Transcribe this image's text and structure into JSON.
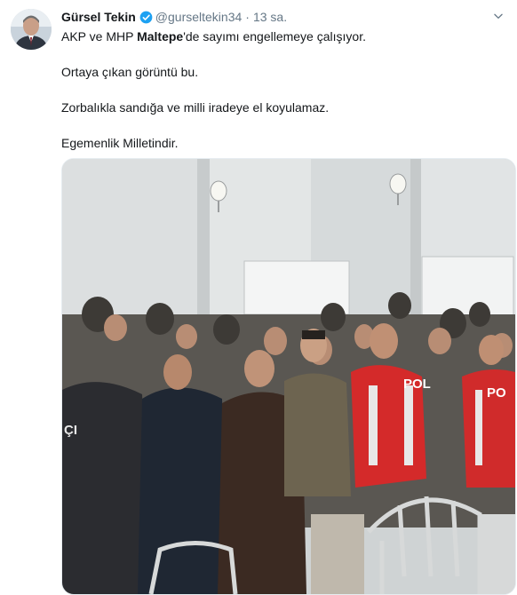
{
  "user": {
    "display_name": "Gürsel Tekin",
    "handle": "@gurseltekin34",
    "time": "13 sa.",
    "separator": "·"
  },
  "tweet": {
    "line1_prefix": "AKP ve MHP ",
    "line1_highlight": "Maltepe",
    "line1_suffix": "'de sayımı engellemeye çalışıyor.",
    "line2": "Ortaya çıkan görüntü bu.",
    "line3": "Zorbalıkla sandığa ve milli iradeye el koyulamaz.",
    "line4": "Egemenlik Milletindir."
  },
  "photo": {
    "vest_text_left": "POL",
    "vest_text_right": "PO",
    "jacket_text": "ÇI"
  },
  "colors": {
    "verified_blue": "#1da1f2",
    "secondary_text": "#657786",
    "primary_text": "#14171a"
  },
  "icons": [
    "verified-badge-icon",
    "chevron-down-icon"
  ]
}
